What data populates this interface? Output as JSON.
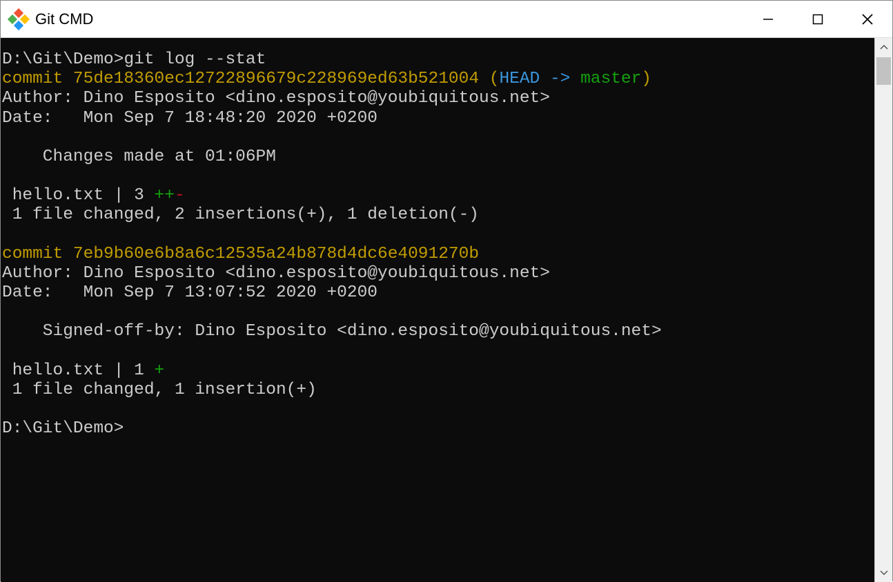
{
  "window": {
    "title": "Git CMD"
  },
  "terminal": {
    "prompt1": "D:\\Git\\Demo>",
    "command1": "git log --stat",
    "commit1": {
      "label": "commit ",
      "hash": "75de18360ec12722896679c228969ed63b521004",
      "ref_open": " (",
      "ref_head": "HEAD -> ",
      "ref_branch": "master",
      "ref_close": ")",
      "author": "Author: Dino Esposito <dino.esposito@youbiquitous.net>",
      "date": "Date:   Mon Sep 7 18:48:20 2020 +0200",
      "message": "    Changes made at 01:06PM",
      "stat_file": " hello.txt | 3 ",
      "stat_plus": "++",
      "stat_minus": "-",
      "stat_summary": " 1 file changed, 2 insertions(+), 1 deletion(-)"
    },
    "commit2": {
      "label": "commit ",
      "hash": "7eb9b60e6b8a6c12535a24b878d4dc6e4091270b",
      "author": "Author: Dino Esposito <dino.esposito@youbiquitous.net>",
      "date": "Date:   Mon Sep 7 13:07:52 2020 +0200",
      "message": "    Signed-off-by: Dino Esposito <dino.esposito@youbiquitous.net>",
      "stat_file": " hello.txt | 1 ",
      "stat_plus": "+",
      "stat_summary": " 1 file changed, 1 insertion(+)"
    },
    "prompt2": "D:\\Git\\Demo>"
  }
}
